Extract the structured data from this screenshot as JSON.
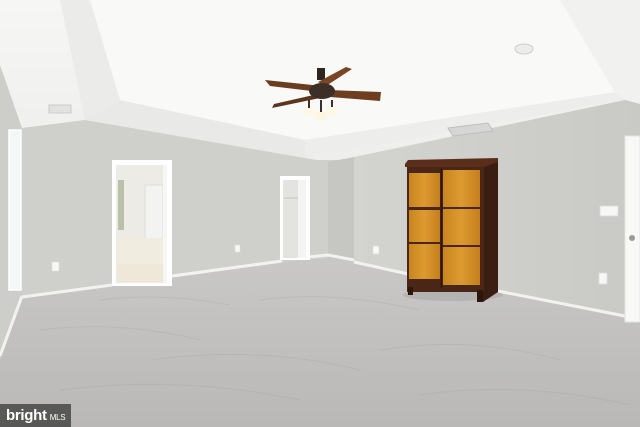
{
  "watermark": {
    "brand": "bright",
    "suffix": "MLS"
  }
}
